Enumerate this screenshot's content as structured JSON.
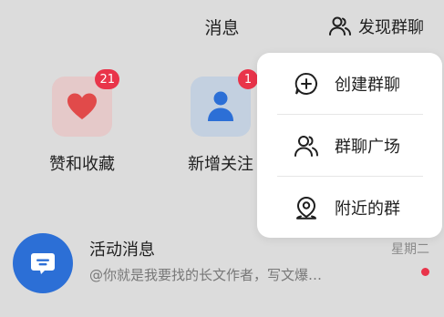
{
  "header": {
    "title": "消息",
    "discover_label": "发现群聊",
    "discover_icon": "people-icon"
  },
  "quick_actions": [
    {
      "label": "赞和收藏",
      "badge": "21",
      "icon": "heart-icon",
      "color": "#e14a4a"
    },
    {
      "label": "新增关注",
      "badge": "1",
      "icon": "person-icon",
      "color": "#2c6fd6"
    }
  ],
  "menu": {
    "items": [
      {
        "label": "创建群聊",
        "icon": "chat-plus-icon"
      },
      {
        "label": "群聊广场",
        "icon": "people-icon"
      },
      {
        "label": "附近的群",
        "icon": "location-icon"
      }
    ]
  },
  "activity": {
    "title": "活动消息",
    "preview": "@你就是我要找的长文作者，写文爆…",
    "time": "星期二",
    "icon": "message-icon",
    "unread": true
  },
  "colors": {
    "accent": "#2c6fd6",
    "badge": "#e9344a",
    "background": "#dcdcdc"
  }
}
